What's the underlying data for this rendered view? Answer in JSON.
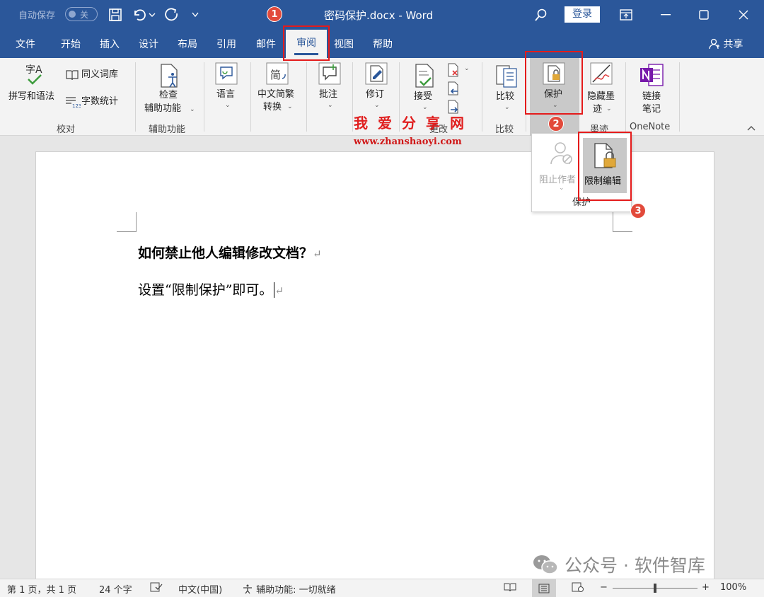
{
  "titlebar": {
    "autosave_label": "自动保存",
    "autosave_state": "关",
    "doc_title": "密码保护.docx  -  Word",
    "login_label": "登录"
  },
  "tabs": [
    "文件",
    "开始",
    "插入",
    "设计",
    "布局",
    "引用",
    "邮件",
    "审阅",
    "视图",
    "帮助"
  ],
  "active_tab": "审阅",
  "share_label": "共享",
  "ribbon": {
    "proofing": {
      "spelling": "拼写和语法",
      "thesaurus": "同义词库",
      "word_count": "字数统计",
      "icon_text": "字A",
      "group": "校对"
    },
    "accessibility": {
      "check_line1": "检查",
      "check_line2": "辅助功能",
      "group": "辅助功能"
    },
    "language": {
      "label": "语言"
    },
    "chinese": {
      "line1": "中文简繁",
      "line2": "转换",
      "icon_text": "简"
    },
    "comments": {
      "label": "批注"
    },
    "tracking": {
      "label": "修订"
    },
    "changes": {
      "accept": "接受",
      "group": "更改"
    },
    "compare": {
      "label": "比较",
      "group": "比较"
    },
    "protect": {
      "label": "保护"
    },
    "ink": {
      "line1": "隐藏墨",
      "line2": "迹",
      "group": "墨迹"
    },
    "onenote": {
      "line1": "链接",
      "line2": "笔记",
      "group": "OneNote"
    }
  },
  "dropdown": {
    "block_authors": "阻止作者",
    "restrict_editing": "限制编辑",
    "group": "保护"
  },
  "document": {
    "line1": "如何禁止他人编辑修改文档？",
    "line2": "设置“限制保护”即可。",
    "pilcrow": "↵"
  },
  "watermark": {
    "text": "我爱分享网",
    "url": "www.zhanshaoyi.com"
  },
  "badges": [
    "1",
    "2",
    "3"
  ],
  "wechat_text": "公众号 · 软件智库",
  "statusbar": {
    "page": "第 1 页，共 1 页",
    "words": "24 个字",
    "language": "中文(中国)",
    "accessibility": "辅助功能: 一切就绪",
    "zoom": "100%"
  },
  "colors": {
    "brand": "#2b579a",
    "highlight": "#e41b1b"
  }
}
